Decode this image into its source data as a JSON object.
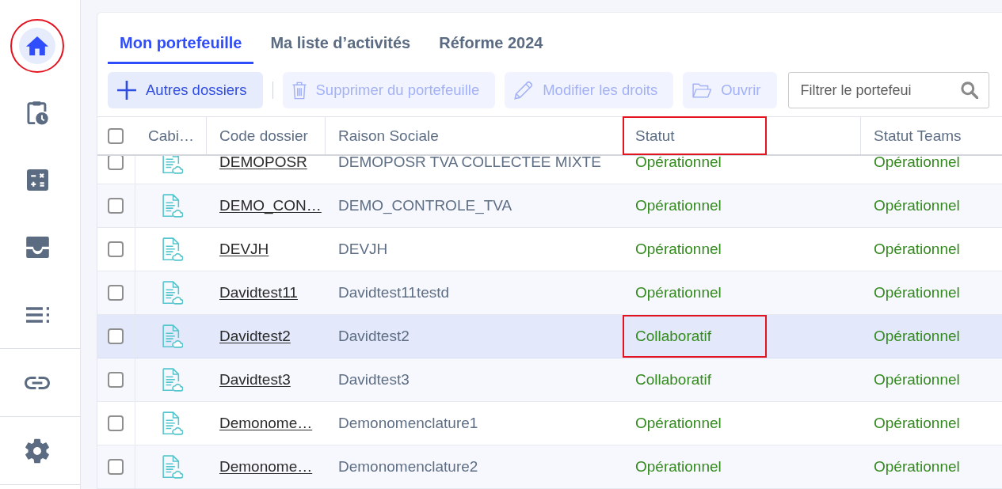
{
  "sidebar": {
    "groups": [
      {
        "items": [
          {
            "selected": true,
            "highlighted": true
          },
          {
            "selected": false,
            "highlighted": false
          },
          {
            "selected": false,
            "highlighted": false
          },
          {
            "selected": false,
            "highlighted": false
          },
          {
            "selected": false,
            "highlighted": false
          }
        ]
      },
      {
        "items": [
          {
            "selected": false,
            "highlighted": false
          }
        ]
      },
      {
        "items": [
          {
            "selected": false,
            "highlighted": false
          }
        ]
      }
    ]
  },
  "tabs": [
    {
      "label": "Mon portefeuille",
      "selected": true
    },
    {
      "label": "Ma liste d’activités",
      "selected": false
    },
    {
      "label": "Réforme 2024",
      "selected": false
    }
  ],
  "toolbar": {
    "groups": [
      {
        "buttons": [
          {
            "label": "Autres dossiers",
            "disabled": false
          }
        ]
      },
      {
        "buttons": [
          {
            "label": "Supprimer du portefeuille",
            "disabled": true
          },
          {
            "label": "Modifier les droits",
            "disabled": true
          },
          {
            "label": "Ouvrir",
            "disabled": true
          }
        ]
      }
    ],
    "search": {
      "placeholder": "Filtrer le portefeui"
    }
  },
  "table": {
    "select_all": {
      "checked": false
    },
    "columns": [
      {
        "label": "Cabi…",
        "highlighted": false
      },
      {
        "label": "Code dossier",
        "highlighted": false
      },
      {
        "label": "Raison Sociale",
        "highlighted": false
      },
      {
        "label": "Statut",
        "highlighted": true
      },
      {
        "label": "Statut Teams",
        "highlighted": false
      }
    ],
    "rows": [
      {
        "checked": false,
        "selected": false,
        "code": "DEMOPOSR",
        "raison_sociale": "DEMOPOSR TVA COLLECTEE MIXTE",
        "statut": "Opérationnel",
        "statut_highlighted": false,
        "statut_teams": "Opérationnel"
      },
      {
        "checked": false,
        "selected": false,
        "code": "DEMO_CON…",
        "raison_sociale": "DEMO_CONTROLE_TVA",
        "statut": "Opérationnel",
        "statut_highlighted": false,
        "statut_teams": "Opérationnel"
      },
      {
        "checked": false,
        "selected": false,
        "code": "DEVJH",
        "raison_sociale": "DEVJH",
        "statut": "Opérationnel",
        "statut_highlighted": false,
        "statut_teams": "Opérationnel"
      },
      {
        "checked": false,
        "selected": false,
        "code": "Davidtest11",
        "raison_sociale": "Davidtest11testd",
        "statut": "Opérationnel",
        "statut_highlighted": false,
        "statut_teams": "Opérationnel"
      },
      {
        "checked": false,
        "selected": true,
        "code": "Davidtest2",
        "raison_sociale": "Davidtest2",
        "statut": "Collaboratif",
        "statut_highlighted": true,
        "statut_teams": "Opérationnel"
      },
      {
        "checked": false,
        "selected": false,
        "code": "Davidtest3",
        "raison_sociale": "Davidtest3",
        "statut": "Collaboratif",
        "statut_highlighted": false,
        "statut_teams": "Opérationnel"
      },
      {
        "checked": false,
        "selected": false,
        "code": "Demonome…",
        "raison_sociale": "Demonomenclature1",
        "statut": "Opérationnel",
        "statut_highlighted": false,
        "statut_teams": "Opérationnel"
      },
      {
        "checked": false,
        "selected": false,
        "code": "Demonome…",
        "raison_sociale": "Demonomenclature2",
        "statut": "Opérationnel",
        "statut_highlighted": false,
        "statut_teams": "Opérationnel"
      }
    ]
  }
}
